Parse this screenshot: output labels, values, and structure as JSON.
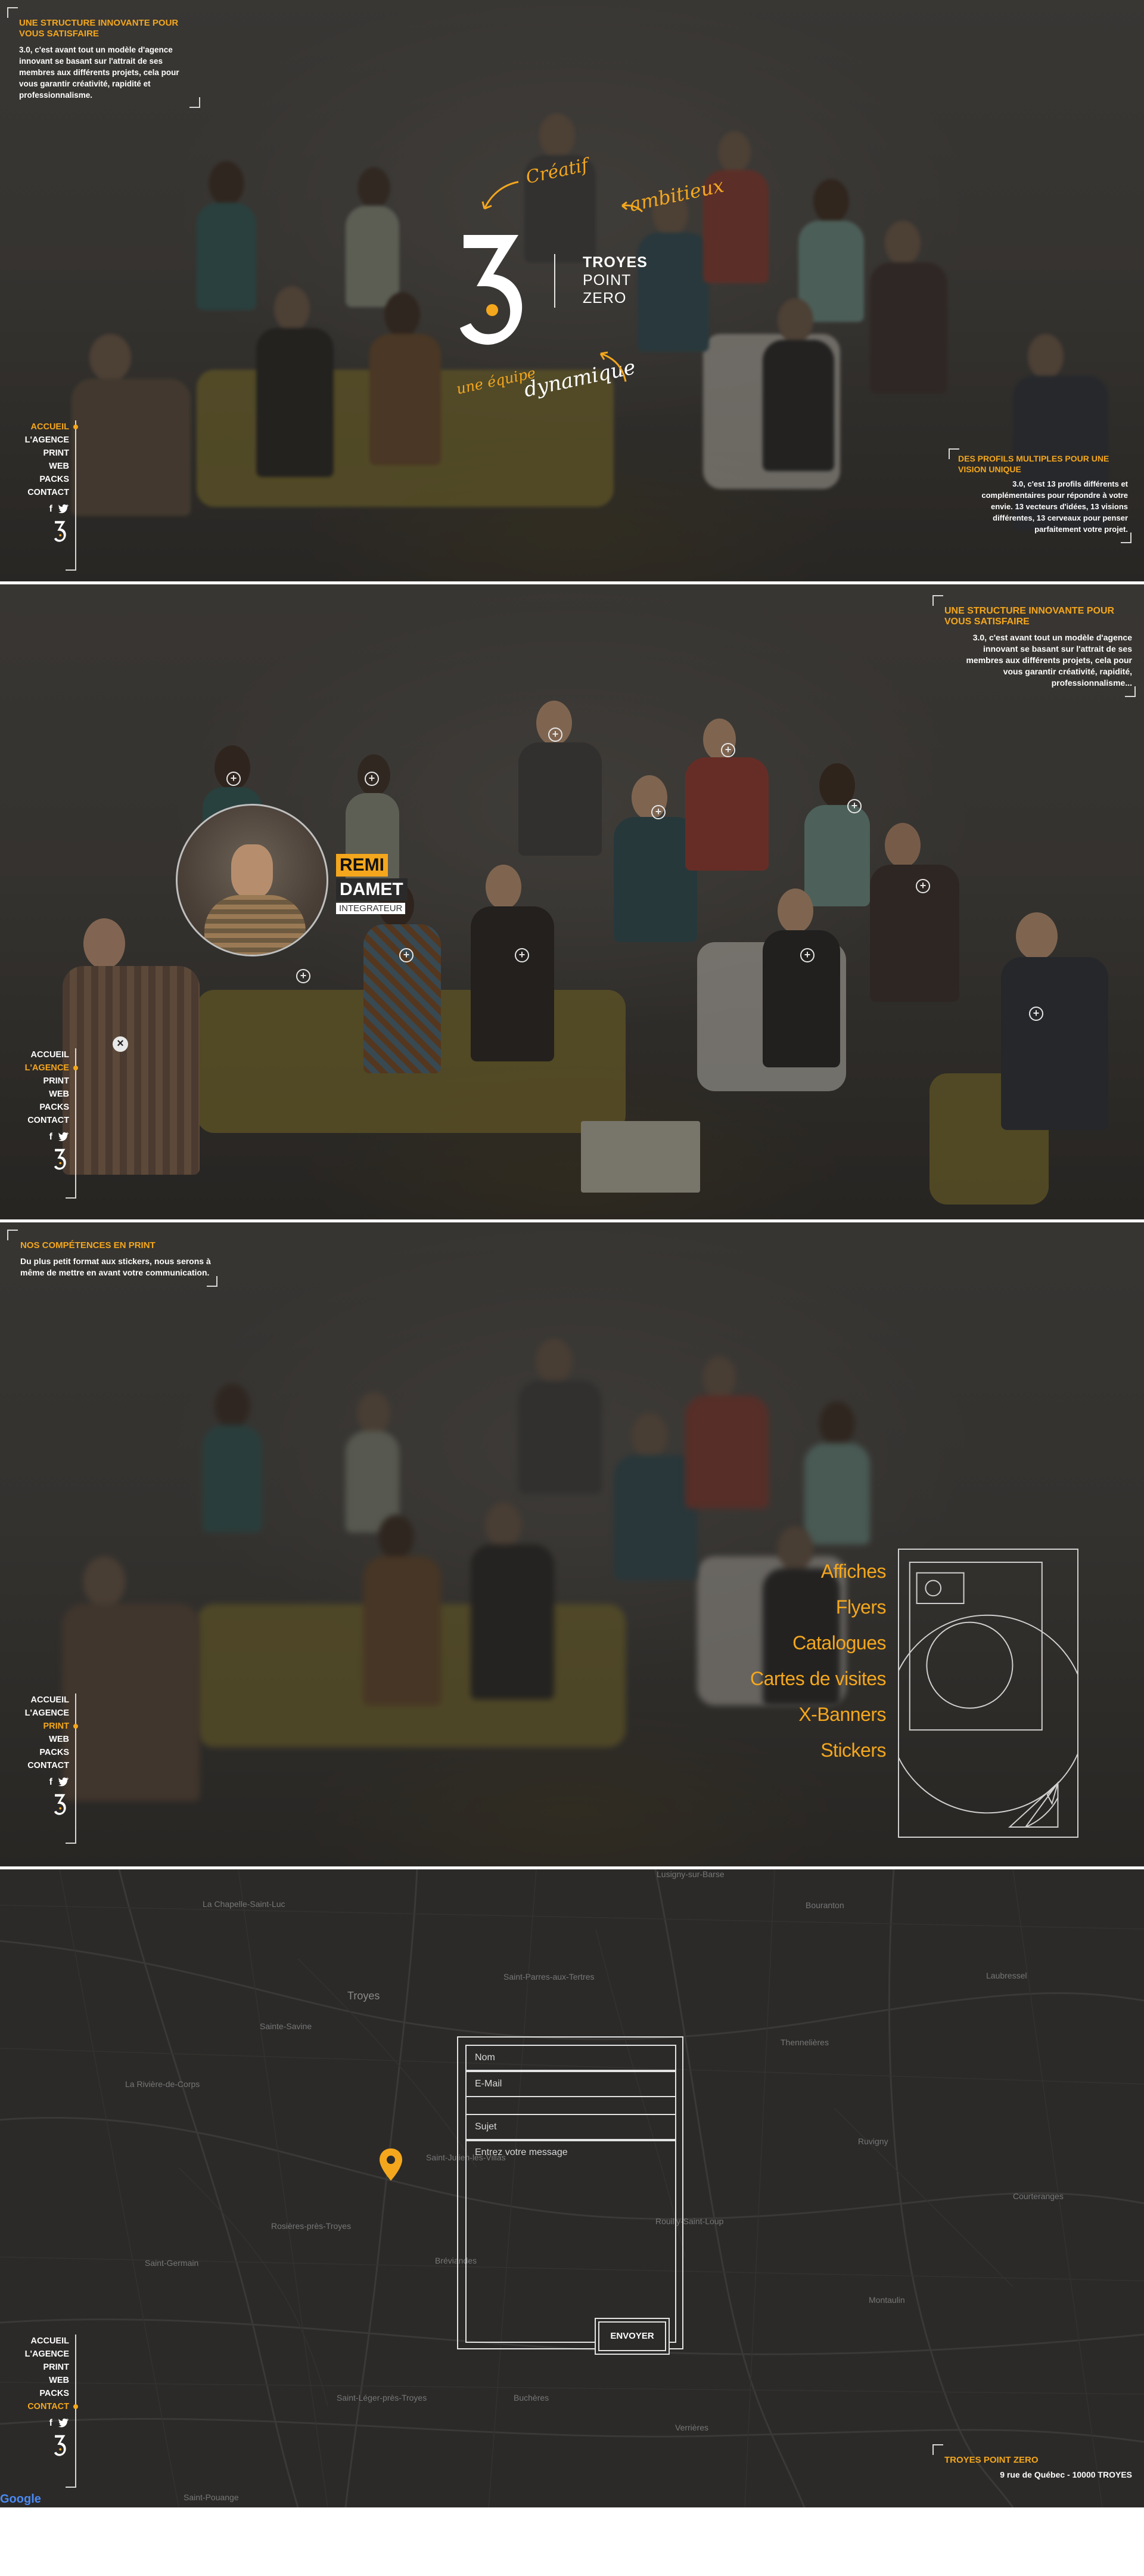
{
  "nav": {
    "items": [
      "ACCUEIL",
      "L'AGENCE",
      "PRINT",
      "WEB",
      "PACKS",
      "CONTACT"
    ],
    "social": {
      "facebook": "f",
      "twitter": "t"
    }
  },
  "hero": {
    "panel_title": "UNE STRUCTURE INNOVANTE POUR VOUS SATISFAIRE",
    "panel_text": "3.0, c'est avant tout un modèle d'agence innovant se basant sur l'attrait de ses membres aux différents projets, cela pour vous garantir créativité, rapidité et professionnalisme.",
    "logo_line1": "TROYES",
    "logo_line2": "POINT",
    "logo_line3": "ZERO",
    "script_creatif": "Créatif",
    "script_ambitieux": "ambitieux",
    "script_une_equipe": "une équipe",
    "script_dynamique": "dynamique",
    "profiles_title": "DES PROFILS MULTIPLES POUR UNE VISION UNIQUE",
    "profiles_text": "3.0, c'est 13 profils différents et complémentaires pour répondre à votre envie. 13 vecteurs d'idées, 13 visions différentes, 13 cerveaux pour penser parfaitement votre projet."
  },
  "agence": {
    "panel_title": "UNE STRUCTURE INNOVANTE POUR VOUS SATISFAIRE",
    "panel_text": "3.0, c'est avant tout un modèle d'agence innovant se basant sur l'attrait de ses membres aux différents projets, cela pour vous garantir créativité, rapidité, professionnalisme...",
    "member_first": "REMI",
    "member_last": "DAMET",
    "member_role": "INTEGRATEUR",
    "close": "×",
    "marker_symbol": "+"
  },
  "print": {
    "panel_title": "NOS COMPÉTENCES EN PRINT",
    "panel_text": "Du plus petit format aux stickers, nous serons à même de mettre en avant votre communication.",
    "items": [
      "Affiches",
      "Flyers",
      "Catalogues",
      "Cartes de visites",
      "X-Banners",
      "Stickers"
    ]
  },
  "contact": {
    "name_placeholder": "Nom",
    "email_placeholder": "E-Mail",
    "subject_placeholder": "Sujet",
    "message_placeholder": "Entrez votre message",
    "send_label": "ENVOYER",
    "address_title": "TROYES POINT ZERO",
    "address_text": "9 rue de Québec - 10000 TROYES",
    "google": "Google",
    "map_labels": [
      "La Chapelle-Saint-Luc",
      "Troyes",
      "Sainte-Savine",
      "Saint-Parres-aux-Tertres",
      "Thennelières",
      "La Rivière-de-Corps",
      "Rosières-près-Troyes",
      "Saint-Germain",
      "Bréviandes",
      "Rouilly-Saint-Loup",
      "Ruvigny",
      "Laubressel",
      "Bouranton",
      "Courteranges",
      "Montaulin",
      "Saint-Léger-près-Troyes",
      "Buchères",
      "Verrières",
      "Saint-Pouange",
      "Saint-Julien-les-Villas",
      "Lusigny-sur-Barse"
    ]
  },
  "colors": {
    "accent": "#f4a71d",
    "map_bg": "#2b2a29"
  }
}
